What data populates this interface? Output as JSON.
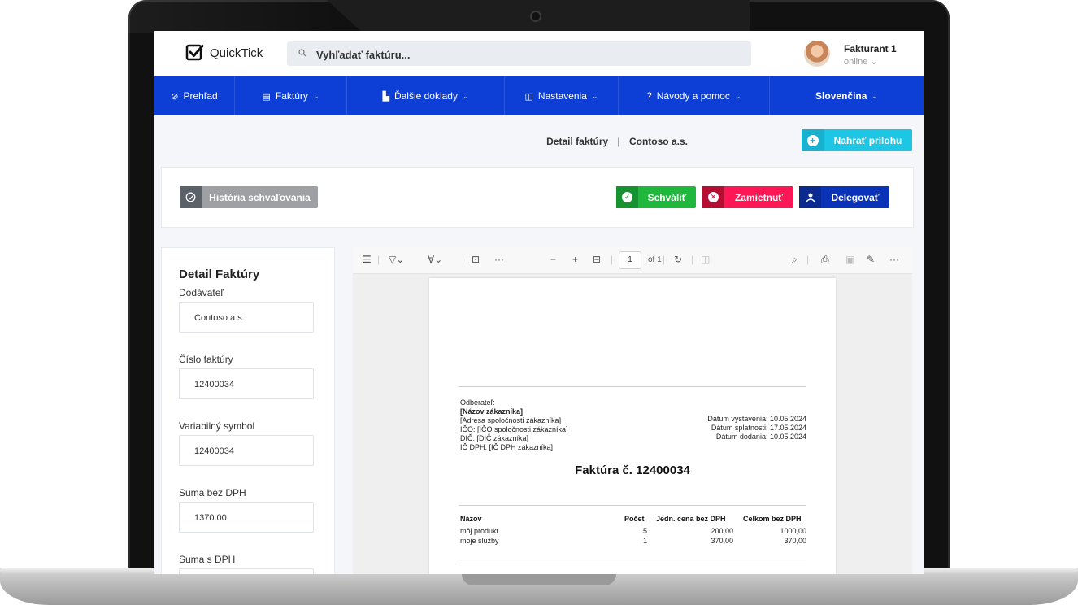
{
  "app": {
    "brand": "QuickTick"
  },
  "search": {
    "placeholder": "Vyhľadať faktúru..."
  },
  "user": {
    "name": "Fakturant 1",
    "status": "online ⌄"
  },
  "nav": {
    "items": [
      {
        "icon": "⊘",
        "label": "Prehľad",
        "chevron": ""
      },
      {
        "icon": "▤",
        "label": "Faktúry",
        "chevron": "⌄"
      },
      {
        "icon": "▙",
        "label": "Ďalšie doklady",
        "chevron": "⌄"
      },
      {
        "icon": "◫",
        "label": "Nastavenia",
        "chevron": "⌄"
      },
      {
        "icon": "?",
        "label": "Návody a pomoc",
        "chevron": "⌄"
      },
      {
        "icon": "",
        "label": "Slovenčina",
        "chevron": "⌄"
      }
    ]
  },
  "breadcrumb": {
    "page": "Detail faktúry",
    "separator": "|",
    "company": "Contoso a.s."
  },
  "actions": {
    "upload": "Nahrať prílohu",
    "history": "História schvaľovania",
    "approve": "Schváliť",
    "reject": "Zamietnuť",
    "delegate": "Delegovať"
  },
  "detail": {
    "title": "Detail Faktúry",
    "fields": [
      {
        "label": "Dodávateľ",
        "value": "Contoso a.s."
      },
      {
        "label": "Číslo faktúry",
        "value": "12400034"
      },
      {
        "label": "Variabilný symbol",
        "value": "12400034"
      },
      {
        "label": "Suma bez DPH",
        "value": "1370.00"
      },
      {
        "label": "Suma s DPH",
        "value": ""
      }
    ]
  },
  "viewer": {
    "page_current": "1",
    "page_total": "of 1"
  },
  "pdf": {
    "customer_label": "Odberateľ:",
    "customer_name": "[Názov zákazníka]",
    "customer_address": "[Adresa spoločnosti zákazníka]",
    "ico": "IČO: [IČO spoločnosti zákazníka]",
    "dic": "DIČ: [DIČ zákazníka]",
    "icdph": "IČ DPH: [IČ DPH zákazníka]",
    "issue_date": "Dátum vystavenia: 10.05.2024",
    "due_date": "Dátum splatnosti: 17.05.2024",
    "delivery_date": "Dátum dodania: 10.05.2024",
    "title": "Faktúra č. 12400034",
    "columns": [
      "Názov",
      "Počet",
      "Jedn. cena bez DPH",
      "Celkom bez DPH"
    ],
    "rows": [
      [
        "môj produkt",
        "5",
        "200,00",
        "1000,00"
      ],
      [
        "moje služby",
        "1",
        "370,00",
        "370,00"
      ]
    ]
  }
}
